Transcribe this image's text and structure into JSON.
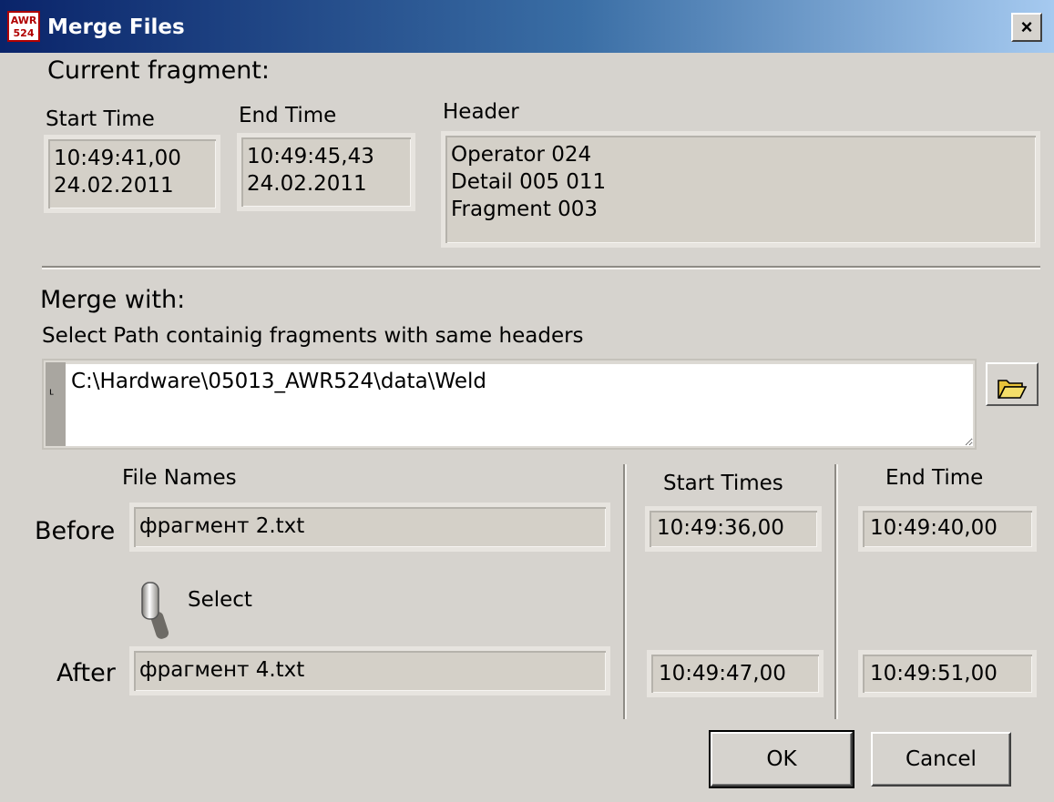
{
  "window": {
    "title": "Merge Files",
    "icon_text": "AWR 524",
    "close_label": "×"
  },
  "current": {
    "section_title": "Current fragment:",
    "start_label": "Start Time",
    "start_value": "10:49:41,00\n24.02.2011",
    "end_label": "End Time",
    "end_value": "10:49:45,43\n24.02.2011",
    "header_label": "Header",
    "header_value": "Operator 024\nDetail 005 011\nFragment 003"
  },
  "merge": {
    "section_title": "Merge with:",
    "instruction": "Select Path containig fragments with same headers",
    "path_value": "C:\\Hardware\\05013_AWR524\\data\\Weld",
    "browse_icon": "folder-open-icon"
  },
  "files": {
    "names_header": "File Names",
    "start_header": "Start Times",
    "end_header": "End Time",
    "before_label": "Before",
    "before_name": "фрагмент 2.txt",
    "before_start": "10:49:36,00",
    "before_end": "10:49:40,00",
    "select_label": "Select",
    "after_label": "After",
    "after_name": "фрагмент 4.txt",
    "after_start": "10:49:47,00",
    "after_end": "10:49:51,00"
  },
  "buttons": {
    "ok": "OK",
    "cancel": "Cancel"
  }
}
